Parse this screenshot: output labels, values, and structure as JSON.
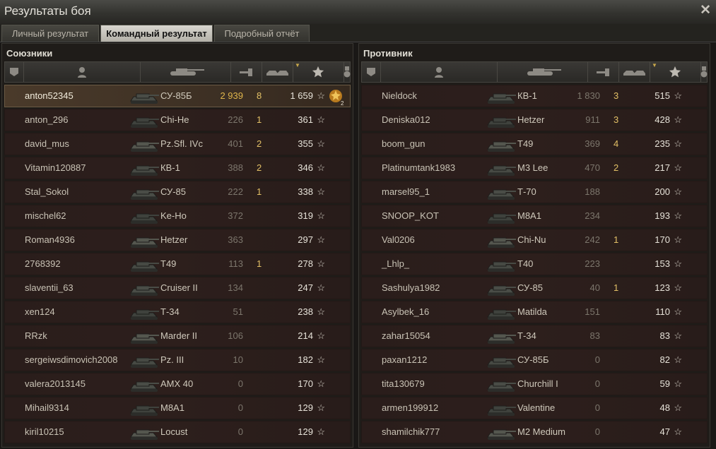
{
  "window": {
    "title": "Результаты боя"
  },
  "tabs": [
    {
      "label": "Личный результат"
    },
    {
      "label": "Командный результат"
    },
    {
      "label": "Подробный отчёт"
    }
  ],
  "allies": {
    "title": "Союзники",
    "rows": [
      {
        "player": "anton52345",
        "tank": "СУ-85Б",
        "damage": "2 939",
        "kills": "8",
        "xp": "1 659",
        "medal": "2"
      },
      {
        "player": "anton_296",
        "tank": "Chi-He",
        "damage": "226",
        "kills": "1",
        "xp": "361"
      },
      {
        "player": "david_mus",
        "tank": "Pz.Sfl. IVc",
        "damage": "401",
        "kills": "2",
        "xp": "355"
      },
      {
        "player": "Vitamin120887",
        "tank": "КВ-1",
        "damage": "388",
        "kills": "2",
        "xp": "346"
      },
      {
        "player": "Stal_Sokol",
        "tank": "СУ-85",
        "damage": "222",
        "kills": "1",
        "xp": "338"
      },
      {
        "player": "mischel62",
        "tank": "Ke-Ho",
        "damage": "372",
        "kills": "",
        "xp": "319"
      },
      {
        "player": "Roman4936",
        "tank": "Hetzer",
        "damage": "363",
        "kills": "",
        "xp": "297"
      },
      {
        "player": "2768392",
        "tank": "T49",
        "damage": "113",
        "kills": "1",
        "xp": "278"
      },
      {
        "player": "slaventii_63",
        "tank": "Cruiser II",
        "damage": "134",
        "kills": "",
        "xp": "247"
      },
      {
        "player": "xen124",
        "tank": "Т-34",
        "damage": "51",
        "kills": "",
        "xp": "238"
      },
      {
        "player": "RRzk",
        "tank": "Marder II",
        "damage": "106",
        "kills": "",
        "xp": "214"
      },
      {
        "player": "sergeiwsdimovich2008",
        "tank": "Pz. III",
        "damage": "10",
        "kills": "",
        "xp": "182"
      },
      {
        "player": "valera2013145",
        "tank": "AMX 40",
        "damage": "0",
        "kills": "",
        "xp": "170"
      },
      {
        "player": "Mihail9314",
        "tank": "M8A1",
        "damage": "0",
        "kills": "",
        "xp": "129"
      },
      {
        "player": "kiril10215",
        "tank": "Locust",
        "damage": "0",
        "kills": "",
        "xp": "129"
      }
    ]
  },
  "enemies": {
    "title": "Противник",
    "rows": [
      {
        "player": "Nieldock",
        "tank": "КВ-1",
        "damage": "1 830",
        "kills": "3",
        "xp": "515"
      },
      {
        "player": "Deniska012",
        "tank": "Hetzer",
        "damage": "911",
        "kills": "3",
        "xp": "428"
      },
      {
        "player": "boom_gun",
        "tank": "T49",
        "damage": "369",
        "kills": "4",
        "xp": "235"
      },
      {
        "player": "Platinumtank1983",
        "tank": "M3 Lee",
        "damage": "470",
        "kills": "2",
        "xp": "217"
      },
      {
        "player": "marsel95_1",
        "tank": "Т-70",
        "damage": "188",
        "kills": "",
        "xp": "200"
      },
      {
        "player": "SNOOP_KOT",
        "tank": "M8A1",
        "damage": "234",
        "kills": "",
        "xp": "193"
      },
      {
        "player": "Val0206",
        "tank": "Chi-Nu",
        "damage": "242",
        "kills": "1",
        "xp": "170"
      },
      {
        "player": "_Lhlp_",
        "tank": "T40",
        "damage": "223",
        "kills": "",
        "xp": "153"
      },
      {
        "player": "Sashulya1982",
        "tank": "СУ-85",
        "damage": "40",
        "kills": "1",
        "xp": "123"
      },
      {
        "player": "Asylbek_16",
        "tank": "Matilda",
        "damage": "151",
        "kills": "",
        "xp": "110"
      },
      {
        "player": "zahar15054",
        "tank": "Т-34",
        "damage": "83",
        "kills": "",
        "xp": "83"
      },
      {
        "player": "paxan1212",
        "tank": "СУ-85Б",
        "damage": "0",
        "kills": "",
        "xp": "82"
      },
      {
        "player": "tita130679",
        "tank": "Churchill I",
        "damage": "0",
        "kills": "",
        "xp": "59"
      },
      {
        "player": "armen199912",
        "tank": "Valentine",
        "damage": "0",
        "kills": "",
        "xp": "48"
      },
      {
        "player": "shamilchik777",
        "tank": "M2 Medium",
        "damage": "0",
        "kills": "",
        "xp": "47"
      }
    ]
  },
  "icons": {
    "close": "close-icon",
    "columns": [
      "platoon-icon",
      "player-icon",
      "tank-icon",
      "damage-icon",
      "kills-icon",
      "experience-star-icon",
      "medal-icon"
    ],
    "row_star": "experience-star-icon",
    "medal": "medal-icon"
  },
  "colors": {
    "row_bg": "#2a1d1b",
    "row_highlight": "#4a3a2a",
    "kills": "#e2c066",
    "damage_highlight": "#e0b64c"
  }
}
